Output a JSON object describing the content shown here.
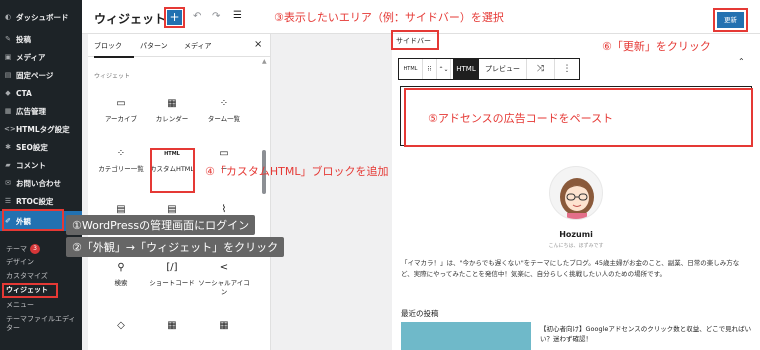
{
  "sidebar": {
    "items": [
      {
        "icon": "dashboard-icon",
        "glyph": "◐",
        "label": "ダッシュボード"
      },
      {
        "icon": "posts-icon",
        "glyph": "✎",
        "label": "投稿"
      },
      {
        "icon": "media-icon",
        "glyph": "▣",
        "label": "メディア"
      },
      {
        "icon": "pages-icon",
        "glyph": "▤",
        "label": "固定ページ"
      },
      {
        "icon": "cta-icon",
        "glyph": "◆",
        "label": "CTA"
      },
      {
        "icon": "ads-icon",
        "glyph": "▦",
        "label": "広告管理"
      },
      {
        "icon": "code-icon",
        "glyph": "<>",
        "label": "HTMLタグ設定"
      },
      {
        "icon": "seo-icon",
        "glyph": "✱",
        "label": "SEO設定"
      },
      {
        "icon": "comments-icon",
        "glyph": "▰",
        "label": "コメント"
      },
      {
        "icon": "mail-icon",
        "glyph": "✉",
        "label": "お問い合わせ"
      },
      {
        "icon": "toc-icon",
        "glyph": "☰",
        "label": "RTOC設定"
      },
      {
        "icon": "appearance-icon",
        "glyph": "✐",
        "label": "外観"
      }
    ],
    "sub": {
      "theme": "テーマ",
      "theme_badge": "3",
      "design": "デザイン",
      "customize": "カスタマイズ",
      "widgets": "ウィジェット",
      "menus": "メニュー",
      "theme_file_editor": "テーマファイルエディター"
    }
  },
  "header": {
    "title": "ウィジェット",
    "add_glyph": "+",
    "undo_glyph": "↶",
    "redo_glyph": "↷",
    "list_glyph": "☰",
    "update_label": "更新"
  },
  "inserter": {
    "tabs": [
      "ブロック",
      "パターン",
      "メディア"
    ],
    "close_glyph": "×",
    "category": "ウィジェット",
    "blocks": [
      {
        "icon": "archive-icon",
        "glyph": "▭",
        "label": "アーカイブ"
      },
      {
        "icon": "calendar-icon",
        "glyph": "▦",
        "label": "カレンダー"
      },
      {
        "icon": "term-list-icon",
        "glyph": "⁘",
        "label": "ターム一覧"
      },
      {
        "icon": "category-list-icon",
        "glyph": "⁘",
        "label": "カテゴリー一覧"
      },
      {
        "icon": "html-icon",
        "glyph": "HTML",
        "label": "カスタムHTML"
      },
      {
        "icon": "comments-block-icon",
        "glyph": "▭",
        "label": "ー"
      },
      {
        "icon": "list-block-icon",
        "glyph": "▤",
        "label": ""
      },
      {
        "icon": "page-list-icon",
        "glyph": "▤",
        "label": ""
      },
      {
        "icon": "rss-icon",
        "glyph": "⌇",
        "label": ""
      },
      {
        "icon": "search-icon",
        "glyph": "⚲",
        "label": "検索"
      },
      {
        "icon": "shortcode-icon",
        "glyph": "[/]",
        "label": "ショートコード"
      },
      {
        "icon": "share-icon",
        "glyph": "<",
        "label": "ソーシャルアイコン"
      },
      {
        "icon": "tag-icon",
        "glyph": "◇",
        "label": ""
      },
      {
        "icon": "calendar-block-icon",
        "glyph": "▦",
        "label": ""
      },
      {
        "icon": "event-icon",
        "glyph": "▦",
        "label": ""
      }
    ]
  },
  "canvas": {
    "area_label": "サイドバー",
    "toolbar": {
      "html_small": "HTML",
      "html": "HTML",
      "preview": "プレビュー",
      "more": "⋮"
    },
    "profile_name": "Hozumi",
    "profile_sub": "こんにちは、ほずみです",
    "description": "「イマカラ！」は、\"今からでも遅くない\"をテーマにしたブログ。45歳主婦がお金のこと、副業、日常の楽しみ方など、実際にやってみたことを発信中！気楽に、自分らしく挑戦したい人のための場所です。",
    "recent_heading": "最近の投稿",
    "recent_post": "【初心者向け】Googleアドセンスのクリック数と収益、どこで見ればいい？迷わず確認！"
  },
  "annotations": {
    "step1": "①WordPressの管理画面にログイン",
    "step2": "②「外観」→「ウィジェット」をクリック",
    "step3": "③表示したいエリア（例：サイドバー）を選択",
    "step4": "④「カスタムHTML」ブロックを追加",
    "step5": "⑤アドセンスの広告コードをペースト",
    "step6": "⑥「更新」をクリック"
  },
  "colors": {
    "accent": "#2271b1",
    "annotation": "#e53935",
    "admin_bg": "#1d2327"
  }
}
